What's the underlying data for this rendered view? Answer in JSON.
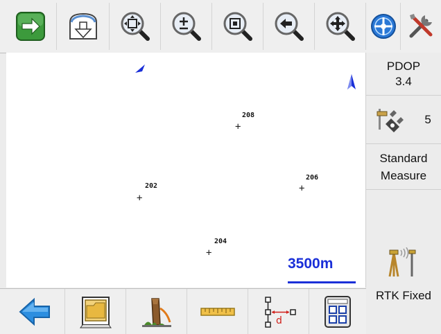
{
  "toolbar": {
    "items": [
      {
        "name": "go-forward-icon"
      },
      {
        "name": "download-data-icon"
      },
      {
        "name": "zoom-fit-icon"
      },
      {
        "name": "zoom-in-out-icon"
      },
      {
        "name": "zoom-window-icon"
      },
      {
        "name": "zoom-previous-icon"
      },
      {
        "name": "pan-icon"
      },
      {
        "name": "gps-target-icon"
      },
      {
        "name": "settings-tools-icon"
      }
    ]
  },
  "map": {
    "points": [
      {
        "id": "208"
      },
      {
        "id": "202"
      },
      {
        "id": "206"
      },
      {
        "id": "204"
      }
    ],
    "scale": "3500m",
    "colors": {
      "accent": "#1a2fd8"
    }
  },
  "side": {
    "pdop_label": "PDOP",
    "pdop_value": "3.4",
    "satellites": "5",
    "mode_line1": "Standard",
    "mode_line2": "Measure",
    "rtk_status": "RTK Fixed"
  },
  "bottombar": {
    "items": [
      {
        "name": "back-arrow-icon"
      },
      {
        "name": "folder-file-icon"
      },
      {
        "name": "stakeout-icon"
      },
      {
        "name": "measure-tape-icon"
      },
      {
        "name": "distance-tool-icon"
      },
      {
        "name": "calculator-grid-icon"
      }
    ]
  }
}
